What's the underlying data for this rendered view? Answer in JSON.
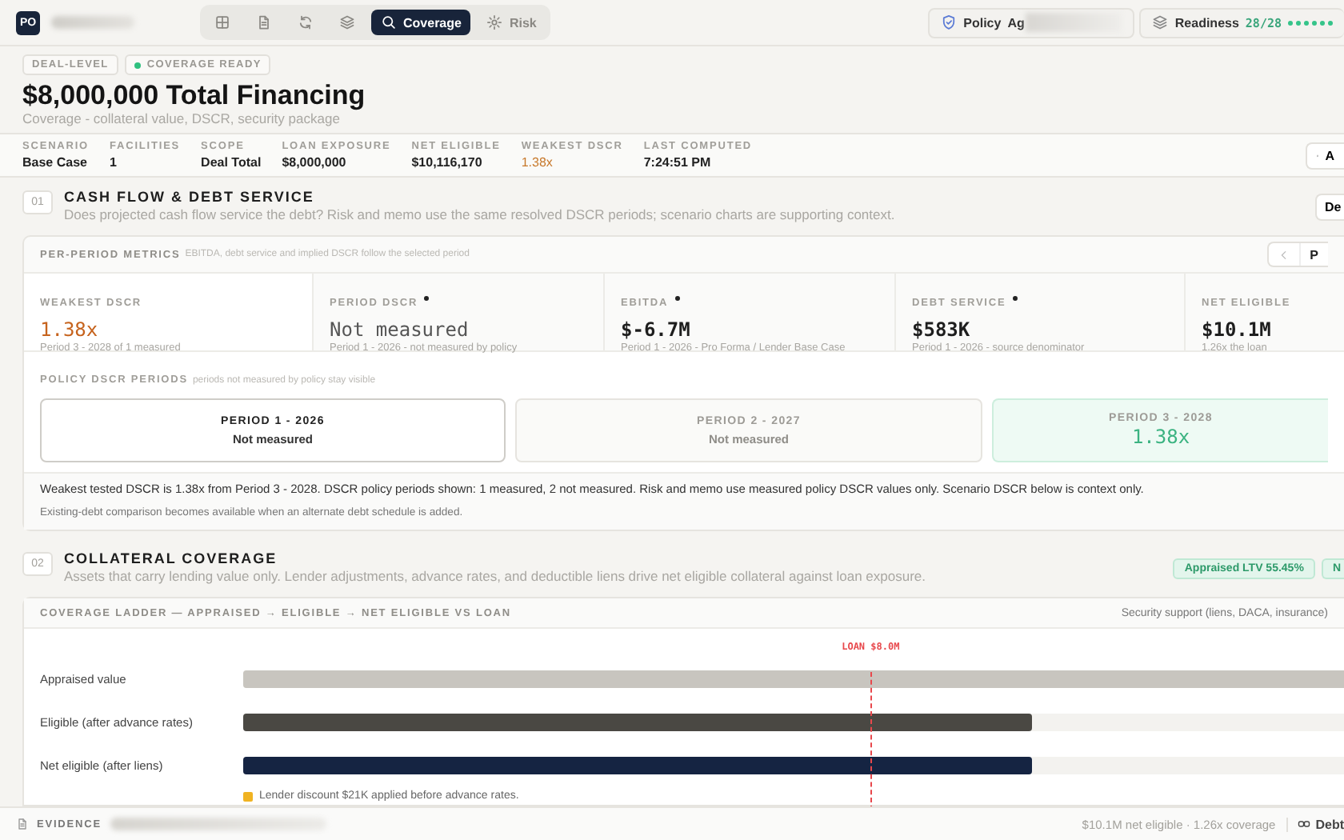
{
  "top_bar": {
    "logo": "PO",
    "tabs": [
      {
        "kind": "grid",
        "selected": false
      },
      {
        "kind": "document",
        "selected": false
      },
      {
        "kind": "refresh",
        "selected": false
      },
      {
        "kind": "layers",
        "selected": false
      },
      {
        "kind": "search",
        "label": "Coverage",
        "selected": true
      },
      {
        "kind": "gear",
        "label": "Risk",
        "selected": false
      }
    ],
    "policy": {
      "label": "Policy",
      "value": "Ag"
    },
    "readiness": {
      "label": "Readiness",
      "value": "28/28"
    }
  },
  "header": {
    "badges": [
      {
        "kind": "plain",
        "text": "DEAL-LEVEL"
      },
      {
        "kind": "status",
        "text": "COVERAGE READY"
      }
    ],
    "title": "$8,000,000 Total Financing",
    "subtitle": "Coverage - collateral value, DSCR, security package"
  },
  "summary": {
    "items": [
      {
        "label": "SCENARIO",
        "value": "Base Case",
        "kind": "normal"
      },
      {
        "label": "FACILITIES",
        "value": "1",
        "kind": "normal"
      },
      {
        "label": "SCOPE",
        "value": "Deal Total",
        "kind": "normal"
      },
      {
        "label": "LOAN EXPOSURE",
        "value": "$8,000,000",
        "kind": "normal"
      },
      {
        "label": "NET ELIGIBLE",
        "value": "$10,116,170",
        "kind": "normal"
      },
      {
        "label": "WEAKEST DSCR",
        "value": "1.38x",
        "kind": "warning"
      },
      {
        "label": "LAST COMPUTED",
        "value": "7:24:51 PM",
        "kind": "normal"
      }
    ],
    "action": "A"
  },
  "cash_flow": {
    "number": "01",
    "title": "CASH FLOW & DEBT SERVICE",
    "subtitle": "Does projected cash flow service the debt? Risk and memo use the same resolved DSCR periods; scenario charts are supporting context.",
    "action": "De",
    "card": {
      "title": "PER-PERIOD METRICS",
      "note": "EBITDA, debt service and implied DSCR follow the selected period",
      "pager": "P",
      "metrics": [
        {
          "label": "WEAKEST DSCR",
          "dot": false,
          "value": "1.38x",
          "kind": "warning",
          "detail": "Period 3 - 2028 of 1 measured"
        },
        {
          "label": "PERIOD DSCR",
          "dot": true,
          "value": "Not measured",
          "kind": "muted",
          "detail": "Period 1 - 2026 - not measured by policy"
        },
        {
          "label": "EBITDA",
          "dot": true,
          "value": "$-6.7M",
          "kind": "normal",
          "detail": "Period 1 - 2026 - Pro Forma / Lender Base Case"
        },
        {
          "label": "DEBT SERVICE",
          "dot": true,
          "value": "$583K",
          "kind": "normal",
          "detail": "Period 1 - 2026 - source denominator"
        },
        {
          "label": "NET ELIGIBLE",
          "dot": false,
          "value": "$10.1M",
          "kind": "normal",
          "detail": "1.26x the loan"
        }
      ],
      "periods_title": "POLICY DSCR PERIODS",
      "periods_note": "periods not measured by policy stay visible",
      "periods": [
        {
          "label": "PERIOD 1 - 2026",
          "value": "Not measured",
          "kind": "not_measured",
          "selected": true
        },
        {
          "label": "PERIOD 2 - 2027",
          "value": "Not measured",
          "kind": "not_measured",
          "selected": false
        },
        {
          "label": "PERIOD 3 - 2028",
          "value": "1.38x",
          "kind": "measured",
          "selected": false
        }
      ],
      "notes": [
        "Weakest tested DSCR is 1.38x from Period 3 - 2028. DSCR policy periods shown: 1 measured, 2 not measured. Risk and memo use measured policy DSCR values only. Scenario DSCR below is context only.",
        "Existing-debt comparison becomes available when an alternate debt schedule is added."
      ]
    }
  },
  "collateral": {
    "number": "02",
    "title": "COLLATERAL COVERAGE",
    "subtitle": "Assets that carry lending value only. Lender adjustments, advance rates, and deductible liens drive net eligible collateral against loan exposure.",
    "badges": [
      "Appraised LTV 55.45%",
      "N"
    ],
    "card": {
      "title": "COVERAGE LADDER — APPRAISED → ELIGIBLE → NET ELIGIBLE VS LOAN",
      "aside": "Security support (liens, DACA, insurance)",
      "loan_marker": {
        "label": "LOAN $8.0M",
        "level": 0.57
      },
      "rows": [
        {
          "label": "Appraised value",
          "kind": "appraised",
          "level": 1
        },
        {
          "label": "Eligible (after advance rates)",
          "kind": "eligible",
          "level": 0.717
        },
        {
          "label": "Net eligible (after liens)",
          "kind": "net",
          "level": 0.717
        }
      ],
      "legend": "Lender discount $21K applied before advance rates."
    }
  },
  "footer": {
    "label": "EVIDENCE",
    "summary": "$10.1M net eligible · 1.26x coverage",
    "action": "Debt"
  }
}
